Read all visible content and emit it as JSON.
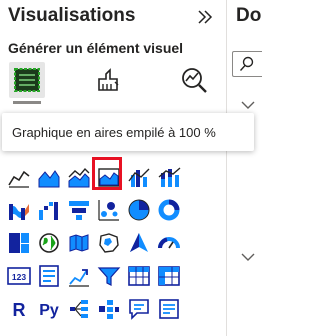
{
  "visualizations": {
    "title": "Visualisations",
    "section_label": "Générer un élément visuel",
    "modes": [
      {
        "name": "build-visual",
        "icon": "build-visual-icon"
      },
      {
        "name": "format-visual",
        "icon": "format-paint-icon"
      },
      {
        "name": "analytics",
        "icon": "analytics-magnifier-icon"
      }
    ],
    "tooltip": "Graphique en aires empilé à 100 %",
    "selected_visual": "100-percent-stacked-area-chart-icon"
  },
  "data_pane": {
    "title": "Do"
  },
  "colors": {
    "accent_blue": "#118dff",
    "dark_navy": "#12239e",
    "selection_red": "#e81123",
    "icon_gray": "#252423"
  }
}
